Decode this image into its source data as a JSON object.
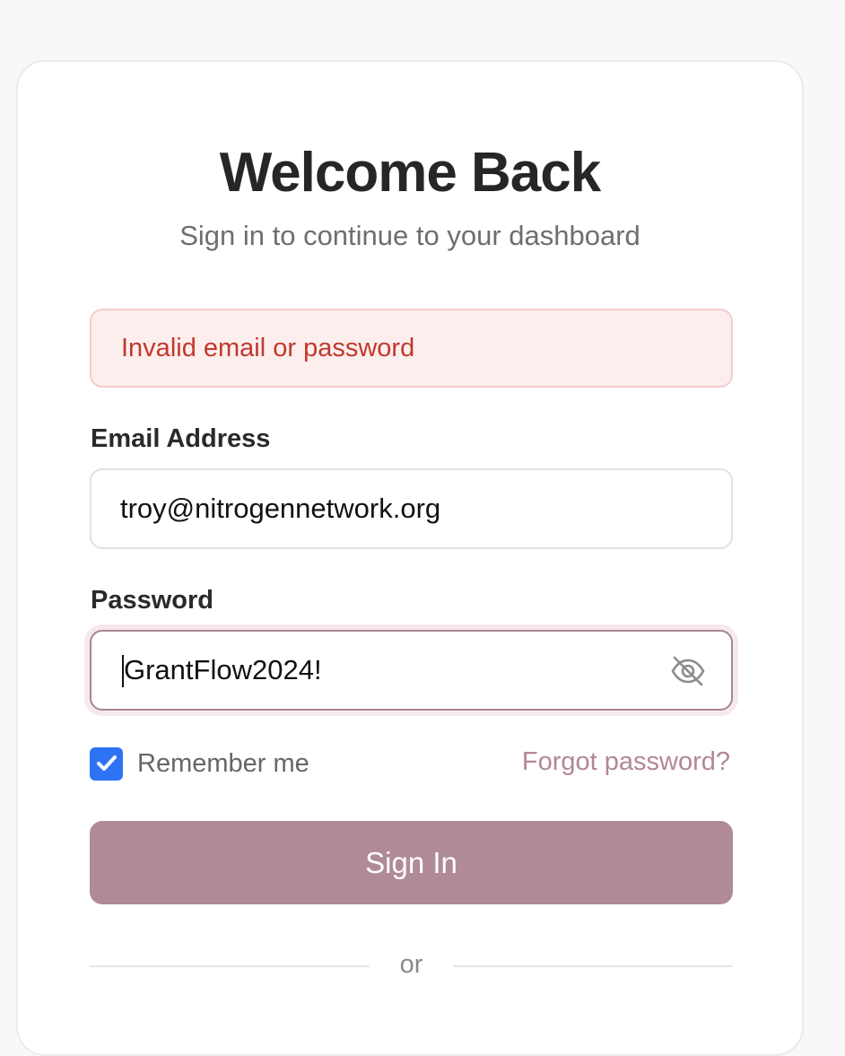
{
  "header": {
    "title": "Welcome Back",
    "subtitle": "Sign in to continue to your dashboard"
  },
  "error": {
    "message": "Invalid email or password",
    "color": "#c0392b"
  },
  "form": {
    "email_label": "Email Address",
    "email_value": "troy@nitrogennetwork.org",
    "password_label": "Password",
    "password_value": "GrantFlow2024!",
    "password_visibility_icon": "eye-off-icon",
    "remember_label": "Remember me",
    "remember_checked": true,
    "forgot_label": "Forgot password?",
    "submit_label": "Sign In",
    "divider_text": "or"
  },
  "colors": {
    "accent": "#b08a97",
    "checkbox": "#2f73f5"
  }
}
